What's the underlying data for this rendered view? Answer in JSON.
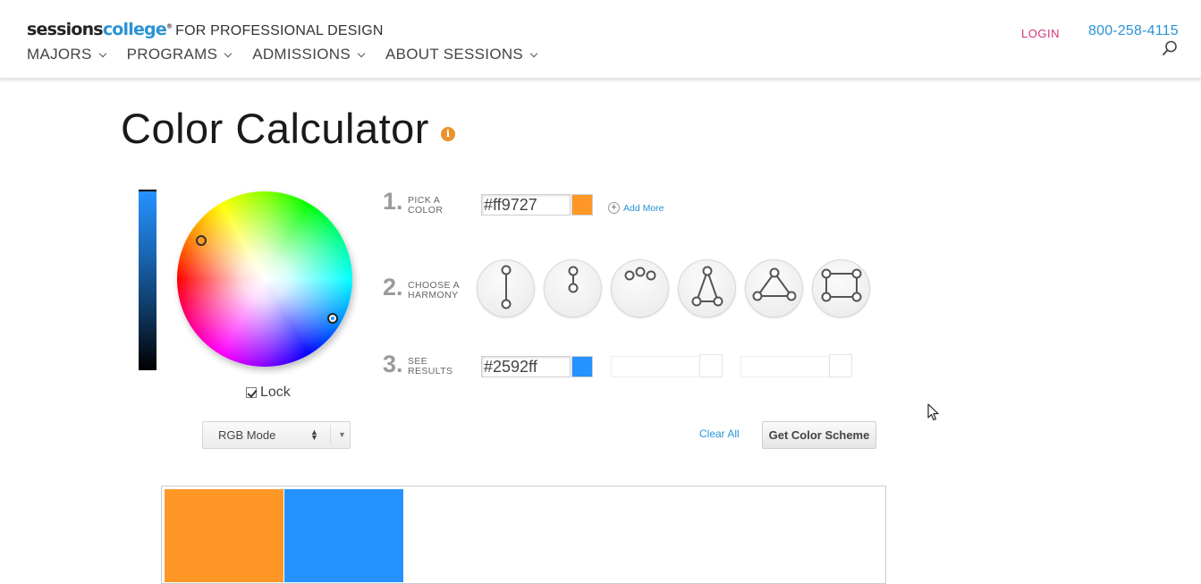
{
  "header": {
    "logo": {
      "brand_part1": "sessions",
      "brand_part2": "college",
      "reg": "®",
      "tagline": "FOR PROFESSIONAL DESIGN"
    },
    "nav": [
      {
        "label": "MAJORS"
      },
      {
        "label": "PROGRAMS"
      },
      {
        "label": "ADMISSIONS"
      },
      {
        "label": "ABOUT SESSIONS"
      }
    ],
    "login_label": "LOGIN",
    "phone": "800-258-4115",
    "search_icon": "search-icon"
  },
  "page": {
    "title": "Color Calculator",
    "info_glyph": "i"
  },
  "picker": {
    "lock_label": "Lock",
    "lock_checked": true,
    "mode_selected": "RGB Mode",
    "wheel_colors": {
      "primary": "#ff9727",
      "secondary": "#2592ff"
    }
  },
  "steps": {
    "step1": {
      "number": "1.",
      "label_line1": "PICK A",
      "label_line2": "COLOR",
      "hex_value": "#ff9727",
      "swatch_color": "#ff9727",
      "add_more_label": "Add More"
    },
    "step2": {
      "number": "2.",
      "label_line1": "CHOOSE A",
      "label_line2": "HARMONY",
      "harmonies": [
        "complementary-icon",
        "split-complementary-icon",
        "analogous-icon",
        "triad-icon",
        "triangle-icon",
        "tetrad-icon"
      ]
    },
    "step3": {
      "number": "3.",
      "label_line1": "SEE",
      "label_line2": "RESULTS",
      "hex_value": "#2592ff",
      "swatch_color": "#2592ff"
    }
  },
  "actions": {
    "clear_all_label": "Clear All",
    "get_scheme_label": "Get Color Scheme"
  },
  "results": {
    "swatches": [
      "#ff9727",
      "#2592ff"
    ]
  },
  "colors": {
    "accent_blue": "#2a93d5",
    "login_pink": "#d6337a",
    "info_orange": "#e8932c"
  }
}
